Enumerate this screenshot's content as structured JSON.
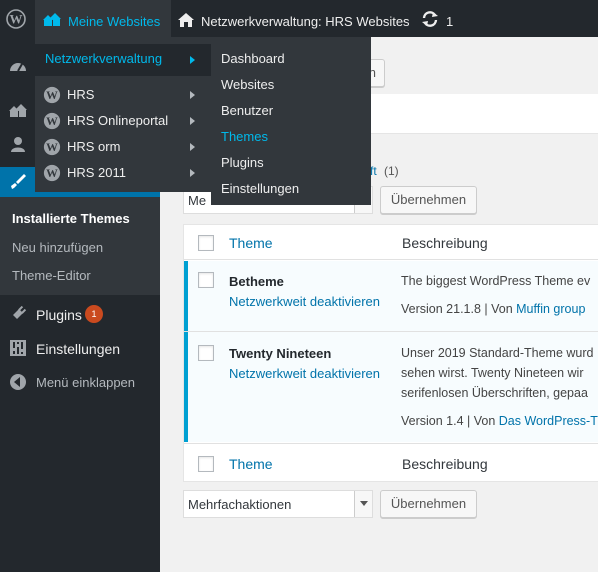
{
  "adminbar": {
    "my_sites": "Meine Websites",
    "network_title": "Netzwerkverwaltung: HRS Websites",
    "updates_count": "1"
  },
  "flyout": {
    "network_admin": "Netzwerkverwaltung",
    "sites": [
      "HRS",
      "HRS Onlineportal",
      "HRS orm",
      "HRS 2011"
    ],
    "network_links": [
      "Dashboard",
      "Websites",
      "Benutzer",
      "Themes",
      "Plugins",
      "Einstellungen"
    ]
  },
  "sidebar": {
    "themes_submenu": [
      "Installierte Themes",
      "Neu hinzufügen",
      "Theme-Editor"
    ],
    "plugins": "Plugins",
    "plugins_badge": "1",
    "settings": "Einstellungen",
    "collapse": "Menü einklappen"
  },
  "main": {
    "top_button": "n",
    "filter_link": "ft",
    "filter_count": "(1)",
    "bulk_top_value": "Me",
    "apply": "Übernehmen",
    "bulk_bottom_value": "Mehrfachaktionen",
    "col_theme": "Theme",
    "col_description": "Beschreibung"
  },
  "themes": [
    {
      "name": "Betheme",
      "action": "Netzwerkweit deaktivieren",
      "desc_lines": [
        "The biggest WordPress Theme ev"
      ],
      "version": "Version 21.1.8 | Von ",
      "author": "Muffin group"
    },
    {
      "name": "Twenty Nineteen",
      "action": "Netzwerkweit deaktivieren",
      "desc_lines": [
        "Unser 2019 Standard-Theme wurd",
        "sehen wirst. Twenty Nineteen wir",
        "serifenlosen Überschriften, gepaa"
      ],
      "version": "Version 1.4 | Von ",
      "author": "Das WordPress-T"
    }
  ],
  "colors": {
    "accent": "#0073aa",
    "highlight": "#00b9eb",
    "dark": "#23282d",
    "badge": "#ca4a1f"
  }
}
